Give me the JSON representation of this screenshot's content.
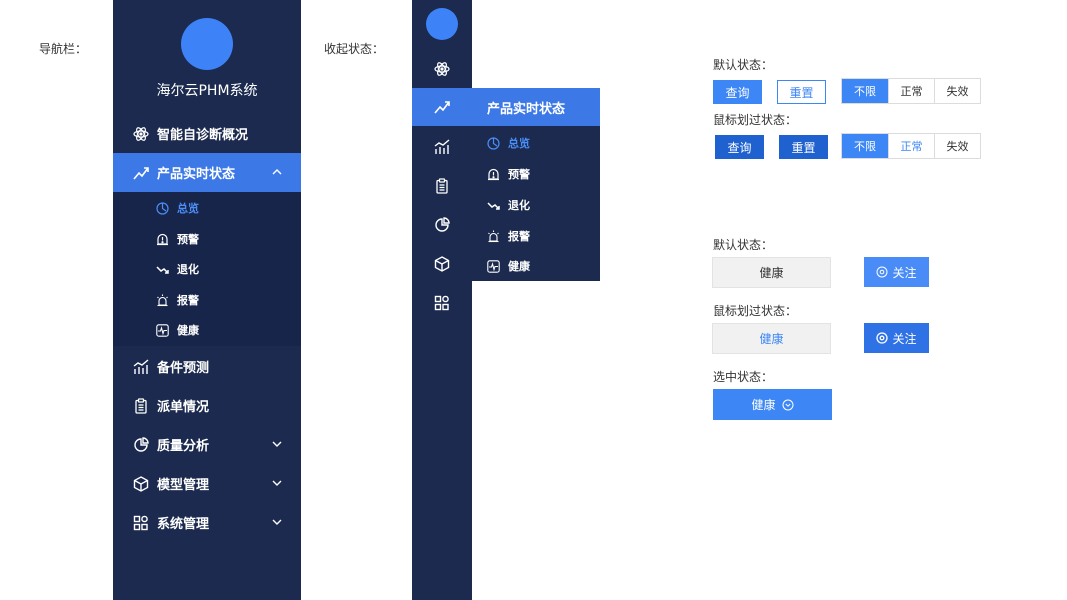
{
  "labels": {
    "nav": "导航栏：",
    "collapsed": "收起状态：",
    "default1": "默认状态：",
    "hover1": "鼠标划过状态：",
    "default2": "默认状态：",
    "hover2": "鼠标划过状态：",
    "selected": "选中状态："
  },
  "sidebar": {
    "brand": "海尔云PHM系统",
    "items": [
      {
        "label": "智能自诊断概况",
        "icon": "atom-icon"
      },
      {
        "label": "产品实时状态",
        "icon": "trend-line-icon"
      },
      {
        "label": "备件预测",
        "icon": "bar-trend-icon"
      },
      {
        "label": "派单情况",
        "icon": "clipboard-icon"
      },
      {
        "label": "质量分析",
        "icon": "pie-icon"
      },
      {
        "label": "模型管理",
        "icon": "cube-icon"
      },
      {
        "label": "系统管理",
        "icon": "grid-icon"
      }
    ],
    "sub_items": [
      {
        "label": "总览",
        "icon": "pie-clock-icon"
      },
      {
        "label": "预警",
        "icon": "alert-bell-icon"
      },
      {
        "label": "退化",
        "icon": "down-trend-icon"
      },
      {
        "label": "报警",
        "icon": "alarm-light-icon"
      },
      {
        "label": "健康",
        "icon": "heartbeat-icon"
      }
    ]
  },
  "flyout": {
    "title": "产品实时状态",
    "items": [
      "总览",
      "预警",
      "退化",
      "报警",
      "健康"
    ]
  },
  "buttons": {
    "query": "查询",
    "reset": "重置",
    "seg": [
      "不限",
      "正常",
      "失效"
    ]
  },
  "tags": {
    "health": "健康",
    "follow": "关注"
  },
  "colors": {
    "sidebar_bg": "#1b2a4e",
    "submenu_bg": "#17254a",
    "active_bg": "#3c79e6",
    "primary": "#3c86f5",
    "primary_hover": "#1f62cf"
  }
}
